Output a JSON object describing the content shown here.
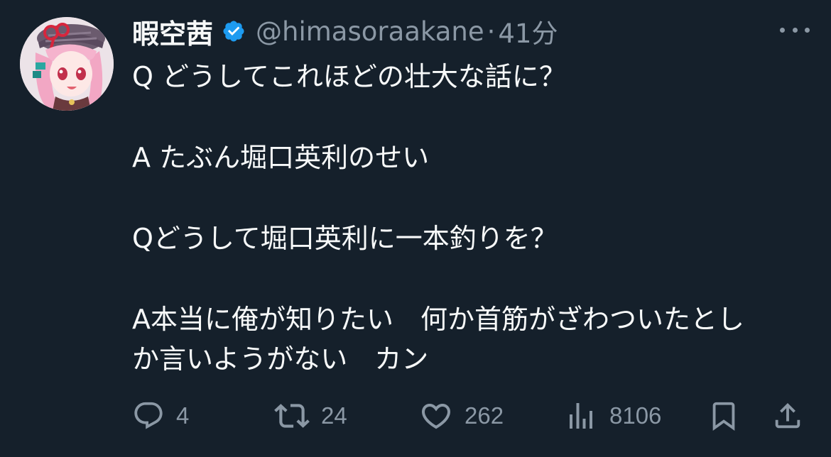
{
  "tweet": {
    "display_name": "暇空茜",
    "handle": "@himasoraakane",
    "separator": "·",
    "time": "41分",
    "verified_color": "#1d9bf0",
    "lines": [
      "Q どうしてこれほどの壮大な話に？",
      "",
      "A たぶん堀口英利のせい",
      "",
      "Qどうして堀口英利に一本釣りを？",
      "",
      "A本当に俺が知りたい　何か首筋がざわついたとし",
      "か言いようがない　カン"
    ]
  },
  "actions": {
    "reply": {
      "icon": "reply-icon",
      "count": "4"
    },
    "retweet": {
      "icon": "retweet-icon",
      "count": "24"
    },
    "like": {
      "icon": "heart-icon",
      "count": "262"
    },
    "views": {
      "icon": "views-icon",
      "count": "8106"
    },
    "bookmark": {
      "icon": "bookmark-icon"
    },
    "share": {
      "icon": "share-icon"
    }
  },
  "colors": {
    "background": "#15202b",
    "text": "#f7f9f9",
    "muted": "#8b98a5"
  }
}
